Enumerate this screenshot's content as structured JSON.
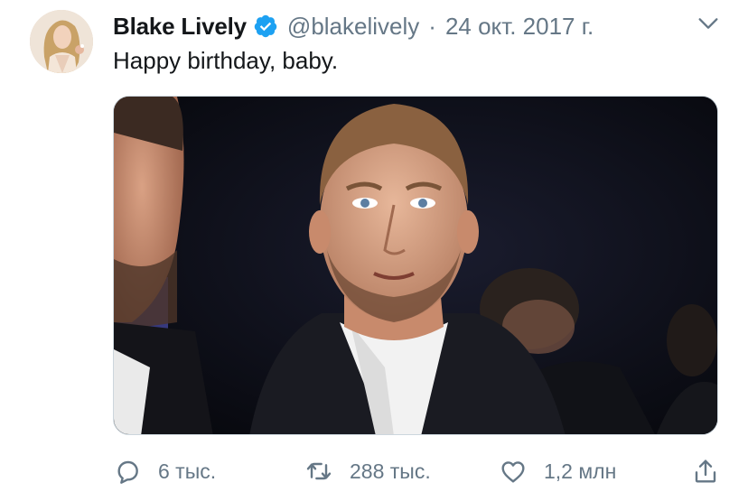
{
  "tweet": {
    "author_name": "Blake Lively",
    "author_handle": "@blakelively",
    "separator": "·",
    "date": "24 окт. 2017 г.",
    "text": "Happy birthday, baby.",
    "verified_color": "#1da1f2",
    "media_description_icon": "photo"
  },
  "actions": {
    "reply": {
      "icon": "reply-icon",
      "count": "6 тыс."
    },
    "retweet": {
      "icon": "retweet-icon",
      "count": "288 тыс."
    },
    "like": {
      "icon": "heart-icon",
      "count": "1,2 млн"
    },
    "share": {
      "icon": "share-icon"
    }
  },
  "colors": {
    "text_primary": "#14171a",
    "text_secondary": "#657786",
    "accent": "#1da1f2"
  }
}
